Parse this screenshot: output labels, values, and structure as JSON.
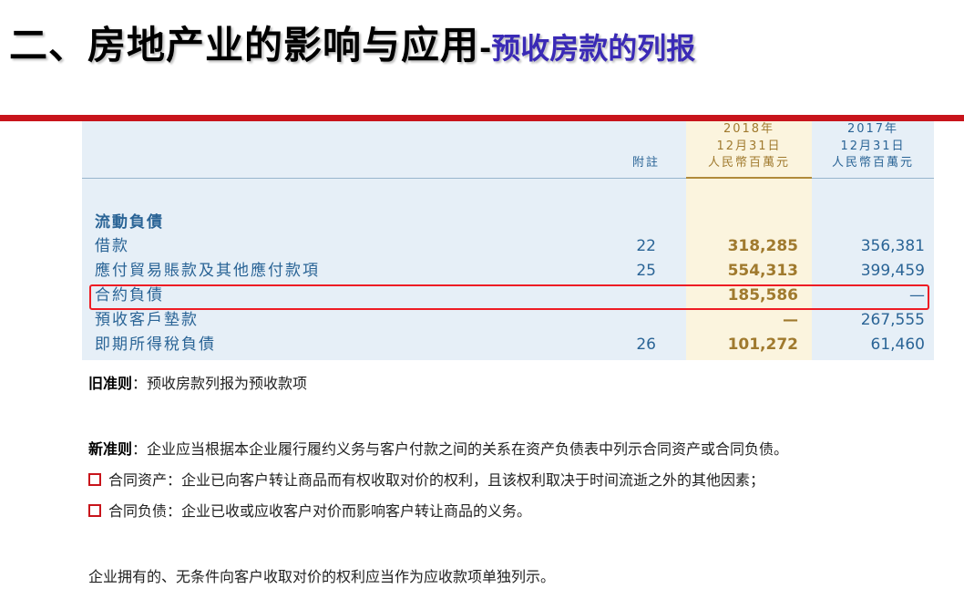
{
  "title": {
    "main": "二、房地产业的影响与应用",
    "dash": "-",
    "sub": "预收房款的列报"
  },
  "table": {
    "header": {
      "note": "附註",
      "col_2018": [
        "2018年",
        "12月31日",
        "人民幣百萬元"
      ],
      "col_2017": [
        "2017年",
        "12月31日",
        "人民幣百萬元"
      ]
    },
    "section": "流動負債",
    "rows": [
      {
        "label": "借款",
        "note": "22",
        "v2018": "318,285",
        "v2017": "356,381"
      },
      {
        "label": "應付貿易賬款及其他應付款項",
        "note": "25",
        "v2018": "554,313",
        "v2017": "399,459"
      },
      {
        "label": "合約負債",
        "note": "",
        "v2018": "185,586",
        "v2017": "—"
      },
      {
        "label": "預收客戶墊款",
        "note": "",
        "v2018": "—",
        "v2017": "267,555"
      },
      {
        "label": "即期所得稅負債",
        "note": "26",
        "v2018": "101,272",
        "v2017": "61,460"
      }
    ]
  },
  "notes": {
    "old_rule_label": "旧准则",
    "old_rule_text": "：预收房款列报为预收款项",
    "new_rule_label": "新准则",
    "new_rule_text": "：企业应当根据本企业履行履约义务与客户付款之间的关系在资产负债表中列示合同资产或合同负债。",
    "bullet1": "合同资产：企业已向客户转让商品而有权收取对价的权利，且该权利取决于时间流逝之外的其他因素；",
    "bullet2": "合同负债：企业已收或应收客户对价而影响客户转让商品的义务。",
    "closing": "企业拥有的、无条件向客户收取对价的权利应当作为应收款项单独列示。"
  },
  "colors": {
    "accent_red": "#c8141b",
    "title_sub": "#3a2ab6",
    "table_blue": "#2a6496",
    "table_gold": "#a07a2e",
    "highlight": "#ee1c24"
  }
}
